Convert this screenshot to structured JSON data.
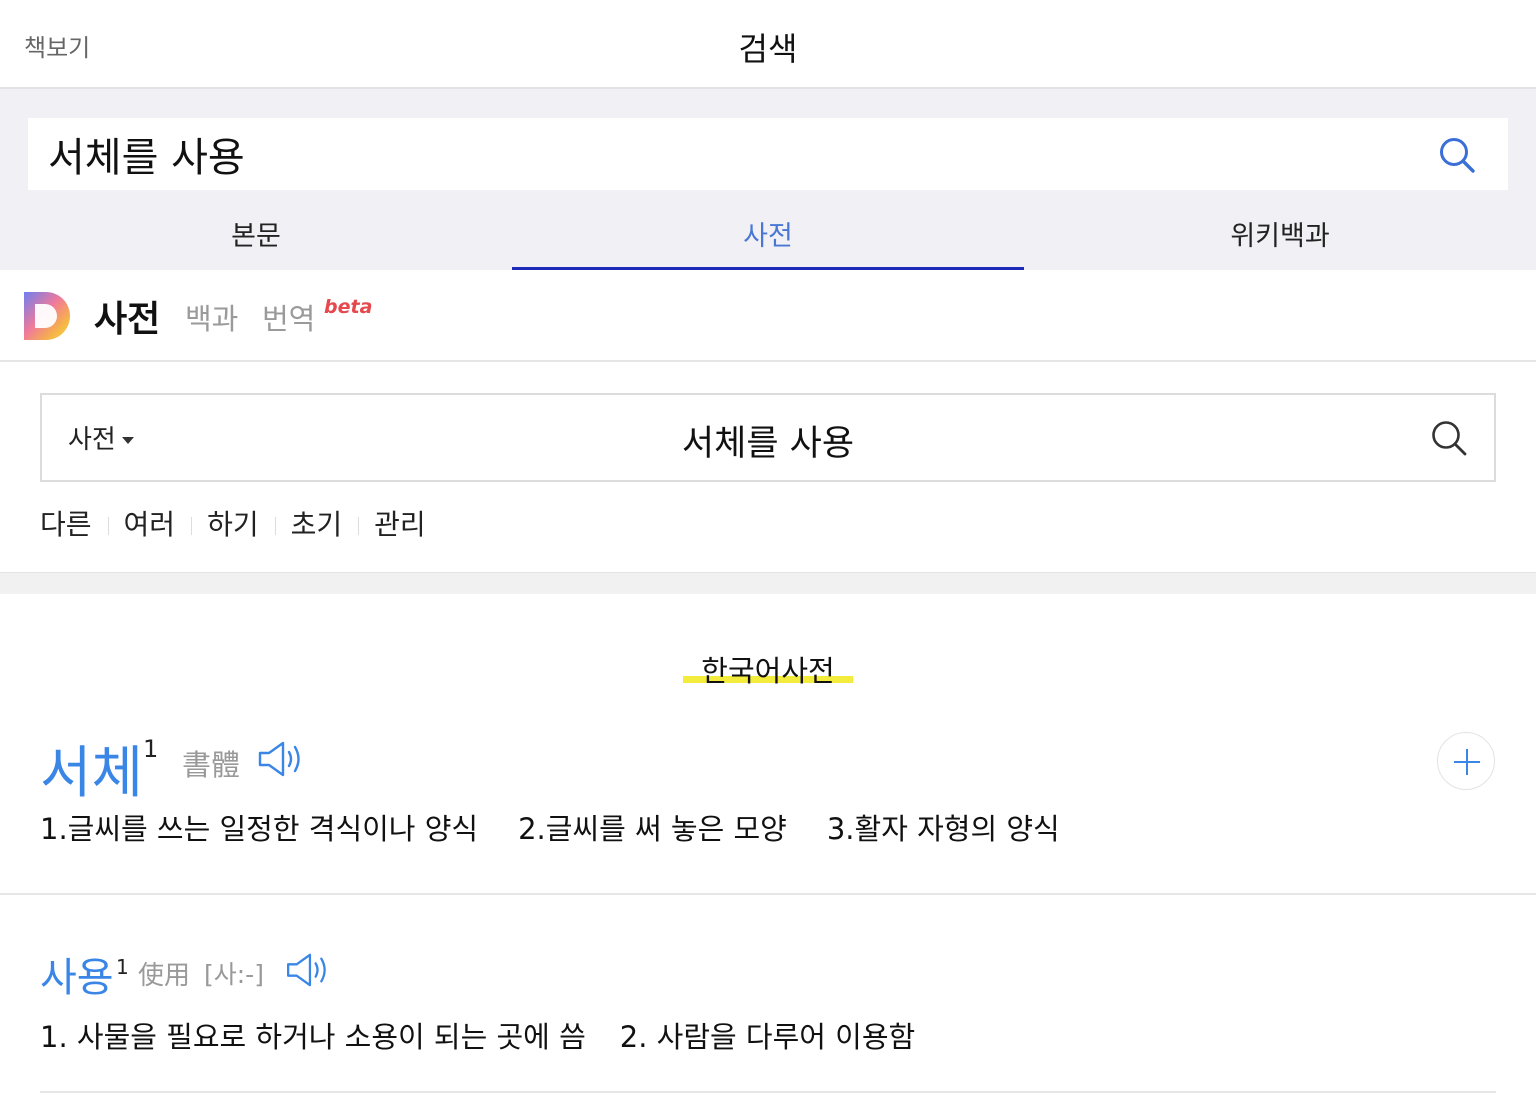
{
  "topbar": {
    "back_label": "책보기",
    "title": "검색"
  },
  "search": {
    "value": "서체를 사용"
  },
  "tabs": [
    {
      "label": "본문"
    },
    {
      "label": "사전"
    },
    {
      "label": "위키백과"
    }
  ],
  "dict_header": {
    "title": "사전",
    "nav": [
      "백과",
      "번역"
    ],
    "beta_label": "beta"
  },
  "dict_search": {
    "selector": "사전",
    "query": "서체를 사용"
  },
  "related": [
    "다른",
    "여러",
    "하기",
    "초기",
    "관리"
  ],
  "section_title": "한국어사전",
  "entries": [
    {
      "word": "서체",
      "sup": "1",
      "hanja": "書體",
      "definitions": [
        "1.글씨를 쓰는 일정한 격식이나 양식",
        "2.글씨를 써 놓은 모양",
        "3.활자 자형의 양식"
      ]
    },
    {
      "word": "사용",
      "sup": "1",
      "hanja": "使用",
      "pron": "[사:-]",
      "definitions": [
        "1. 사물을 필요로 하거나 소용이 되는 곳에 씀",
        "2. 사람을 다루어 이용함"
      ]
    }
  ],
  "colors": {
    "accent_blue": "#3a86e6",
    "tab_underline": "#1d2bb8",
    "highlight_yellow": "#f3ec3c",
    "beta_red": "#e5484d"
  },
  "icons": [
    "search-icon",
    "dictionary-logo-icon",
    "caret-down-icon",
    "speaker-icon",
    "plus-icon"
  ]
}
